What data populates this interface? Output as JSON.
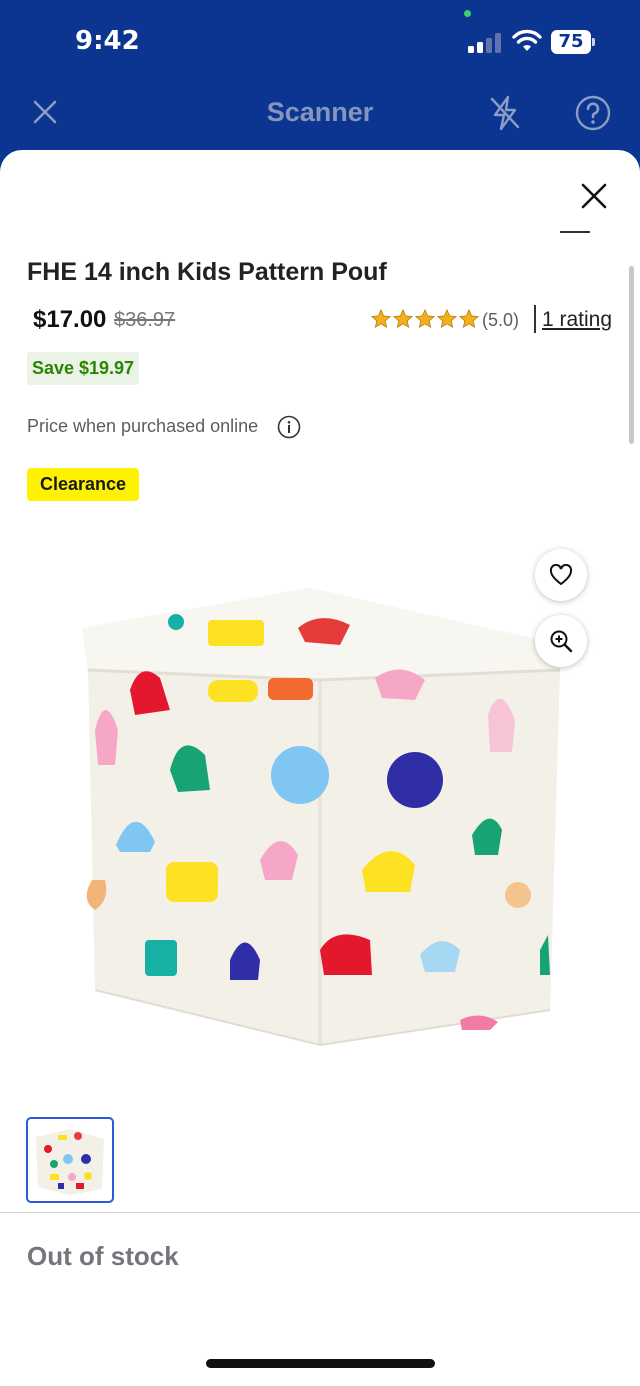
{
  "status_bar": {
    "time": "9:42",
    "battery": "75"
  },
  "nav": {
    "title": "Scanner"
  },
  "product": {
    "title": "FHE 14 inch Kids Pattern Pouf",
    "price": "$17.00",
    "was_price": "$36.97",
    "rating_value": "(5.0)",
    "rating_stars": 5,
    "rating_link": "1 rating",
    "save_badge": "Save $19.97",
    "price_note": "Price when purchased online",
    "clearance_label": "Clearance",
    "availability": "Out of stock"
  },
  "colors": {
    "brand_blue": "#0b3590",
    "save_green": "#2a8703",
    "clearance_yellow": "#fff200",
    "star_yellow": "#f2b01e"
  },
  "icons": [
    "close-icon",
    "flash-off-icon",
    "help-icon",
    "heart-icon",
    "zoom-in-icon",
    "info-icon",
    "star-icon"
  ]
}
